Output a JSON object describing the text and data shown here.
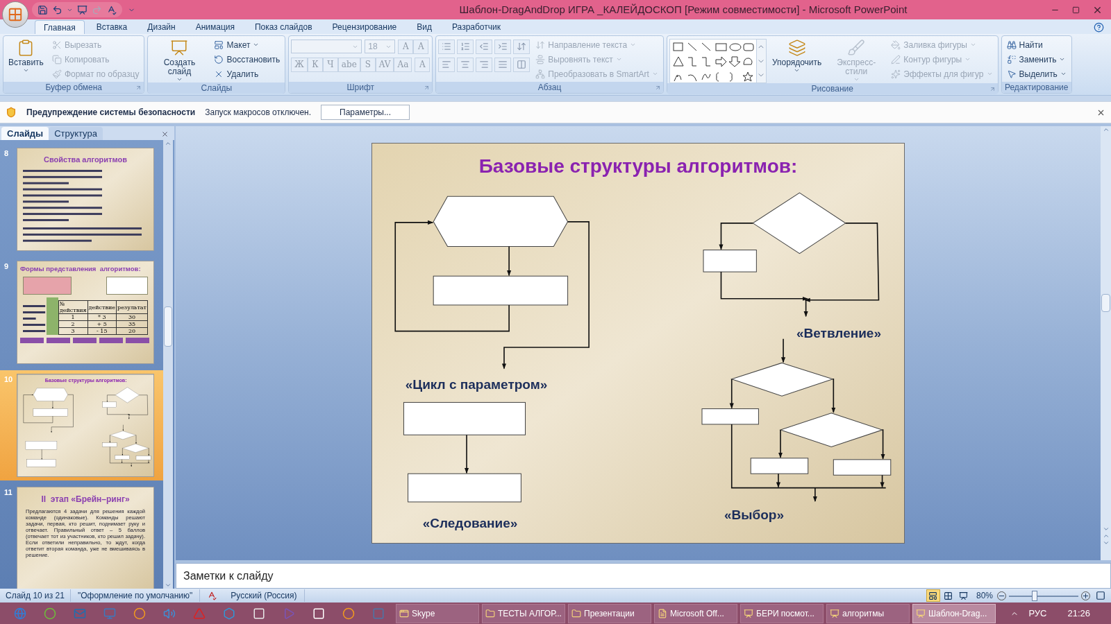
{
  "window": {
    "title": "Шаблон-DragAndDrop ИГРА _КАЛЕЙДОСКОП [Режим совместимости] - Microsoft PowerPoint"
  },
  "ribbon": {
    "tabs": [
      {
        "label": "Главная",
        "selected": true
      },
      {
        "label": "Вставка",
        "selected": false
      },
      {
        "label": "Дизайн",
        "selected": false
      },
      {
        "label": "Анимация",
        "selected": false
      },
      {
        "label": "Показ слайдов",
        "selected": false
      },
      {
        "label": "Рецензирование",
        "selected": false
      },
      {
        "label": "Вид",
        "selected": false
      },
      {
        "label": "Разработчик",
        "selected": false
      }
    ],
    "groups": [
      {
        "label": "Буфер обмена",
        "launcher": true,
        "columns": [
          [
            {
              "kind": "large",
              "label": "Вставить",
              "menu": true,
              "disabled": false
            }
          ],
          [
            {
              "kind": "small",
              "label": "Вырезать",
              "menu": false,
              "disabled": true
            },
            {
              "kind": "small",
              "label": "Копировать",
              "menu": false,
              "disabled": true
            },
            {
              "kind": "small",
              "label": "Формат по образцу",
              "menu": false,
              "disabled": true
            }
          ]
        ]
      },
      {
        "label": "Слайды",
        "launcher": false,
        "columns": [
          [
            {
              "kind": "large",
              "label": "Создать слайд",
              "menu": true,
              "disabled": false
            }
          ],
          [
            {
              "kind": "small",
              "label": "Макет",
              "menu": true,
              "disabled": false
            },
            {
              "kind": "small",
              "label": "Восстановить",
              "menu": false,
              "disabled": false
            },
            {
              "kind": "small",
              "label": "Удалить",
              "menu": false,
              "disabled": false
            }
          ]
        ]
      },
      {
        "label": "Шрифт",
        "launcher": true,
        "columns": [
          [
            {
              "kind": "row",
              "items": [
                {
                  "kind": "field",
                  "disabled": true
                },
                {
                  "kind": "field",
                  "value": "18",
                  "disabled": true
                },
                {
                  "kind": "glyphs",
                  "labels": [
                    "A",
                    "A"
                  ],
                  "disabled": true
                }
              ]
            },
            {
              "kind": "row",
              "items": [
                {
                  "kind": "glyphs",
                  "labels": [
                    "Ж",
                    "К",
                    "Ч",
                    "abe",
                    "S",
                    "AV",
                    "Aa"
                  ],
                  "disabled": true
                },
                {
                  "kind": "glyphs",
                  "labels": [
                    "A"
                  ],
                  "disabled": true
                }
              ]
            }
          ]
        ]
      },
      {
        "label": "Абзац",
        "launcher": true,
        "columns": [
          [
            {
              "kind": "list-tools",
              "disabled": true
            },
            {
              "kind": "align-tools",
              "disabled": true
            }
          ],
          [
            {
              "kind": "small",
              "label": "Направление текста",
              "menu": true,
              "disabled": true
            },
            {
              "kind": "small",
              "label": "Выровнять текст",
              "menu": true,
              "disabled": true
            },
            {
              "kind": "small",
              "label": "Преобразовать в SmartArt",
              "menu": true,
              "disabled": true
            }
          ]
        ]
      },
      {
        "label": "Рисование",
        "launcher": true,
        "columns": [
          [
            {
              "kind": "gallery",
              "disabled": false
            }
          ],
          [
            {
              "kind": "large",
              "label": "Упорядочить",
              "menu": true,
              "disabled": false
            }
          ],
          [
            {
              "kind": "large",
              "label": "Экспресс-стили",
              "menu": true,
              "disabled": true
            }
          ],
          [
            {
              "kind": "small",
              "label": "Заливка фигуры",
              "menu": true,
              "disabled": true
            },
            {
              "kind": "small",
              "label": "Контур фигуры",
              "menu": true,
              "disabled": true
            },
            {
              "kind": "small",
              "label": "Эффекты для фигур",
              "menu": true,
              "disabled": true
            }
          ]
        ]
      },
      {
        "label": "Редактирование",
        "launcher": false,
        "columns": [
          [
            {
              "kind": "small",
              "label": "Найти",
              "menu": false,
              "disabled": false
            },
            {
              "kind": "small",
              "label": "Заменить",
              "menu": true,
              "disabled": false
            },
            {
              "kind": "small",
              "label": "Выделить",
              "menu": true,
              "disabled": false
            }
          ]
        ]
      }
    ]
  },
  "security_bar": {
    "title": "Предупреждение системы безопасности",
    "message": "Запуск макросов отключен.",
    "button": "Параметры..."
  },
  "slides_panel": {
    "tabs": [
      {
        "label": "Слайды",
        "selected": true
      },
      {
        "label": "Структура",
        "selected": false
      }
    ],
    "thumbnails": [
      {
        "number": "8",
        "kind": "text",
        "selected": false,
        "title": "Свойства алгоритмов"
      },
      {
        "number": "9",
        "kind": "forms",
        "selected": false,
        "title": "Формы представления  алгоритмов:",
        "table": {
          "columns": [
            "№ действия",
            "действие",
            "результат"
          ],
          "rows": [
            [
              "1",
              "* 3",
              "30"
            ],
            [
              "2",
              "+ 5",
              "35"
            ],
            [
              "3",
              "- 15",
              "20"
            ]
          ]
        }
      },
      {
        "number": "10",
        "kind": "flowchart",
        "selected": true,
        "title": "Базовые структуры алгоритмов:"
      },
      {
        "number": "11",
        "kind": "paragraph",
        "selected": false,
        "title": "II  этап «Брейн–ринг»",
        "body": "Предлагаются 4 задачи для  решения  каждой команде (одинаковые). Команды решают задачи, первая,  кто решит, поднимает руку и отвечает. Правильный ответ – 5 баллов (отвечает тот из участников, кто решил задачу). Если ответили неправильно, то ждут, когда ответит вторая команда, уже не вмешиваясь в решение."
      }
    ]
  },
  "slide": {
    "title": "Базовые структуры алгоритмов:",
    "labels": [
      "«Цикл с параметром»",
      "«Следование»",
      "«Ветвление»",
      "«Выбор»"
    ]
  },
  "notes": {
    "text": "Заметки к слайду"
  },
  "status_bar": {
    "slide": "Слайд 10 из 21",
    "theme": "\"Оформление по умолчанию\"",
    "language": "Русский (Россия)",
    "views": [
      {
        "selected": true
      },
      {
        "selected": false
      },
      {
        "selected": false
      }
    ],
    "zoom": "80%",
    "zoom_slider": {
      "level": 0.37
    }
  },
  "taskbar": {
    "tasks": [
      {
        "label": "Skype",
        "selected": false
      },
      {
        "label": "ТЕСТЫ АЛГОР...",
        "selected": false
      },
      {
        "label": "Презентации",
        "selected": false
      },
      {
        "label": "Microsoft Off...",
        "selected": false
      },
      {
        "label": "БЕРИ  посмот...",
        "selected": false
      },
      {
        "label": "алгоритмы",
        "selected": false
      },
      {
        "label": "Шаблон-Drag...",
        "selected": true
      }
    ],
    "language": "РУС",
    "time": "21:26"
  }
}
